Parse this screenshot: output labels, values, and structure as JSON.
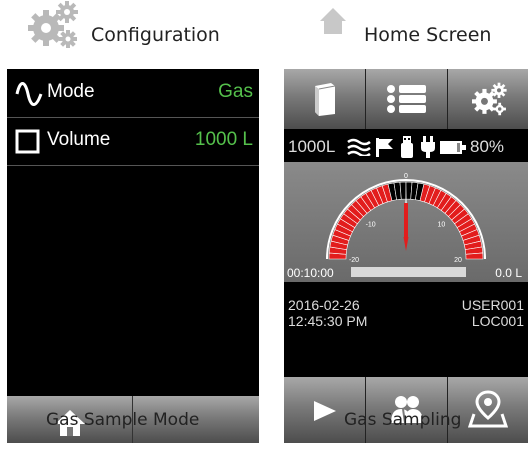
{
  "left": {
    "header_title": "Configuration",
    "rows": [
      {
        "label": "Mode",
        "value": "Gas",
        "icon": "wave-icon"
      },
      {
        "label": "Volume",
        "value": "1000 L",
        "icon": "square-icon"
      }
    ],
    "caption": "Gas Sample Mode"
  },
  "right": {
    "header_title": "Home Screen",
    "status": {
      "volume": "1000L",
      "battery": "80%"
    },
    "gauge": {
      "ticks": [
        "-20",
        "-10",
        "0",
        "10",
        "20"
      ],
      "needle_value": 0
    },
    "timer": {
      "elapsed": "00:10:00",
      "volume": "0.0 L",
      "progress": 0
    },
    "info": {
      "date": "2016-02-26",
      "time": "12:45:30 PM",
      "user": "USER001",
      "location": "LOC001"
    },
    "caption": "Gas Sampling"
  },
  "colors": {
    "accent_green": "#55c04c",
    "gauge_red": "#e21d1d",
    "gauge_black": "#000000"
  }
}
